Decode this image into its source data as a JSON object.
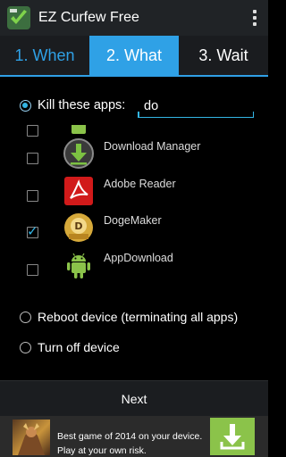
{
  "app": {
    "title": "EZ Curfew Free",
    "icon": "ez-curfew-app-icon",
    "overflow_icon": "more-vert-icon"
  },
  "tabs": [
    {
      "label": "1. When",
      "active": false
    },
    {
      "label": "2. What",
      "active": true
    },
    {
      "label": "3. Wait",
      "active": false
    }
  ],
  "kill_option": {
    "label": "Kill these apps:",
    "selected": true
  },
  "filter": {
    "value": "do"
  },
  "apps": [
    {
      "name": "Download Manager",
      "checked": false,
      "icon": "download-manager-icon"
    },
    {
      "name": "Adobe Reader",
      "checked": false,
      "icon": "adobe-reader-icon"
    },
    {
      "name": "DogeMaker",
      "checked": true,
      "icon": "dogemaker-icon"
    },
    {
      "name": "AppDownload",
      "checked": false,
      "icon": "android-icon"
    }
  ],
  "reboot_option": {
    "label": "Reboot device (terminating all apps)",
    "selected": false
  },
  "turnoff_option": {
    "label": "Turn off device",
    "selected": false
  },
  "next_button": {
    "label": "Next"
  },
  "ad": {
    "line1": "Best game of 2014 on your device.",
    "line2": "Play at your own risk.",
    "download_icon": "download-icon"
  },
  "colors": {
    "accent": "#33b5e5",
    "actionbar": "#202326",
    "ad_button": "#8bc34a"
  }
}
